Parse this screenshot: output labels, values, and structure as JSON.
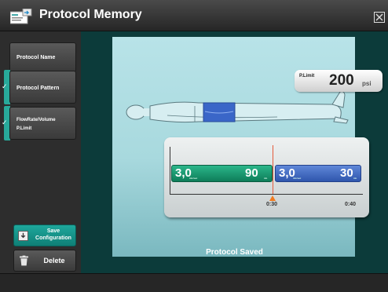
{
  "window": {
    "title": "Protocol Memory",
    "close_icon": "close-icon"
  },
  "sidebar": {
    "items": [
      {
        "label": "Protocol Name",
        "checked": false
      },
      {
        "label": "Protocol Pattern",
        "checked": true
      },
      {
        "label_lines": [
          "FlowRate/Volume",
          "P.Limit"
        ],
        "checked": true
      }
    ],
    "save_button": {
      "label_lines": [
        "Save",
        "Configuration"
      ],
      "icon": "save-download-icon"
    },
    "delete_button": {
      "label": "Delete",
      "icon": "trash-icon"
    }
  },
  "pressure_limit": {
    "label": "P.Limit",
    "value": "200",
    "unit": "psi"
  },
  "timeline": {
    "phases": [
      {
        "rate": "3,0",
        "rate_unit": "mL/sec",
        "volume": "90",
        "volume_unit": "mL",
        "color": "#1d9b72"
      },
      {
        "rate": "3,0",
        "rate_unit": "mL/sec",
        "volume": "30",
        "volume_unit": "mL",
        "color": "#3f6ac4"
      }
    ],
    "time_labels": [
      "0:30",
      "0:40"
    ],
    "marker_color": "#f07a1e"
  },
  "status": "Protocol Saved",
  "colors": {
    "accent": "#1ea79c",
    "background": "#0c3b3a"
  }
}
